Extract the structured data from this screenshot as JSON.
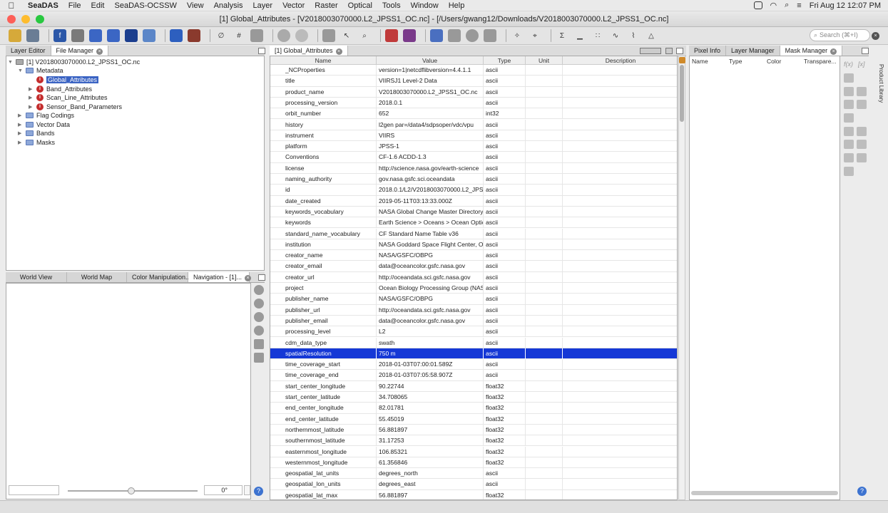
{
  "menubar": {
    "app": "SeaDAS",
    "items": [
      "File",
      "Edit",
      "SeaDAS-OCSSW",
      "View",
      "Analysis",
      "Layer",
      "Vector",
      "Raster",
      "Optical",
      "Tools",
      "Window",
      "Help"
    ],
    "clock": "Fri Aug 12  12:07 PM"
  },
  "window": {
    "title": "[1] Global_Attributes - [V2018003070000.L2_JPSS1_OC.nc] - [/Users/gwang12/Downloads/V2018003070000.L2_JPSS1_OC.nc]"
  },
  "toolbar": {
    "search_placeholder": "Search (⌘+I)"
  },
  "left_top_tabs": [
    "Layer Editor",
    "File Manager"
  ],
  "tree": {
    "root": "[1] V2018003070000.L2_JPSS1_OC.nc",
    "metadata": "Metadata",
    "meta_items": [
      "Global_Attributes",
      "Band_Attributes",
      "Scan_Line_Attributes",
      "Sensor_Band_Parameters"
    ],
    "groups": [
      "Flag Codings",
      "Vector Data",
      "Bands",
      "Masks"
    ]
  },
  "left_bottom_tabs": [
    "World View",
    "World Map",
    "Color Manipulation...",
    "Navigation - [1]..."
  ],
  "nav": {
    "angle": "0°"
  },
  "center_tab": "[1] Global_Attributes",
  "table": {
    "columns": [
      "Name",
      "Value",
      "Type",
      "Unit",
      "Description"
    ],
    "selected_index": 26,
    "rows": [
      [
        "_NCProperties",
        "version=1|netcdflibversion=4.4.1.1",
        "ascii"
      ],
      [
        "title",
        "VIIRSJ1 Level-2 Data",
        "ascii"
      ],
      [
        "product_name",
        "V2018003070000.L2_JPSS1_OC.nc",
        "ascii"
      ],
      [
        "processing_version",
        "2018.0.1",
        "ascii"
      ],
      [
        "orbit_number",
        "652",
        "int32"
      ],
      [
        "history",
        "l2gen par=/data4/sdpsoper/vdc/vpu",
        "ascii"
      ],
      [
        "instrument",
        "VIIRS",
        "ascii"
      ],
      [
        "platform",
        "JPSS-1",
        "ascii"
      ],
      [
        "Conventions",
        "CF-1.6 ACDD-1.3",
        "ascii"
      ],
      [
        "license",
        "http://science.nasa.gov/earth-science",
        "ascii"
      ],
      [
        "naming_authority",
        "gov.nasa.gsfc.sci.oceandata",
        "ascii"
      ],
      [
        "id",
        "2018.0.1/L2/V2018003070000.L2_JPSS1",
        "ascii"
      ],
      [
        "date_created",
        "2019-05-11T03:13:33.000Z",
        "ascii"
      ],
      [
        "keywords_vocabulary",
        "NASA Global Change Master Directory",
        "ascii"
      ],
      [
        "keywords",
        "Earth Science > Oceans > Ocean Optics",
        "ascii"
      ],
      [
        "standard_name_vocabulary",
        "CF Standard Name Table v36",
        "ascii"
      ],
      [
        "institution",
        "NASA Goddard Space Flight Center, Oc",
        "ascii"
      ],
      [
        "creator_name",
        "NASA/GSFC/OBPG",
        "ascii"
      ],
      [
        "creator_email",
        "data@oceancolor.gsfc.nasa.gov",
        "ascii"
      ],
      [
        "creator_url",
        "http://oceandata.sci.gsfc.nasa.gov",
        "ascii"
      ],
      [
        "project",
        "Ocean Biology Processing Group (NASA",
        "ascii"
      ],
      [
        "publisher_name",
        "NASA/GSFC/OBPG",
        "ascii"
      ],
      [
        "publisher_url",
        "http://oceandata.sci.gsfc.nasa.gov",
        "ascii"
      ],
      [
        "publisher_email",
        "data@oceancolor.gsfc.nasa.gov",
        "ascii"
      ],
      [
        "processing_level",
        "L2",
        "ascii"
      ],
      [
        "cdm_data_type",
        "swath",
        "ascii"
      ],
      [
        "spatialResolution",
        "750 m",
        "ascii"
      ],
      [
        "time_coverage_start",
        "2018-01-03T07:00:01.589Z",
        "ascii"
      ],
      [
        "time_coverage_end",
        "2018-01-03T07:05:58.907Z",
        "ascii"
      ],
      [
        "start_center_longitude",
        "90.22744",
        "float32"
      ],
      [
        "start_center_latitude",
        "34.708065",
        "float32"
      ],
      [
        "end_center_longitude",
        "82.01781",
        "float32"
      ],
      [
        "end_center_latitude",
        "55.45019",
        "float32"
      ],
      [
        "northernmost_latitude",
        "56.881897",
        "float32"
      ],
      [
        "southernmost_latitude",
        "31.17253",
        "float32"
      ],
      [
        "easternmost_longitude",
        "106.85321",
        "float32"
      ],
      [
        "westernmost_longitude",
        "61.356846",
        "float32"
      ],
      [
        "geospatial_lat_units",
        "degrees_north",
        "ascii"
      ],
      [
        "geospatial_lon_units",
        "degrees_east",
        "ascii"
      ],
      [
        "geospatial_lat_max",
        "56.881897",
        "float32"
      ]
    ]
  },
  "right_tabs": [
    "Pixel Info",
    "Layer Manager",
    "Mask Manager"
  ],
  "mask_columns": [
    "Name",
    "Type",
    "Color",
    "Transpare..."
  ],
  "side_label": "Product Library",
  "fx_labels": [
    "f(x)",
    "[x]"
  ]
}
